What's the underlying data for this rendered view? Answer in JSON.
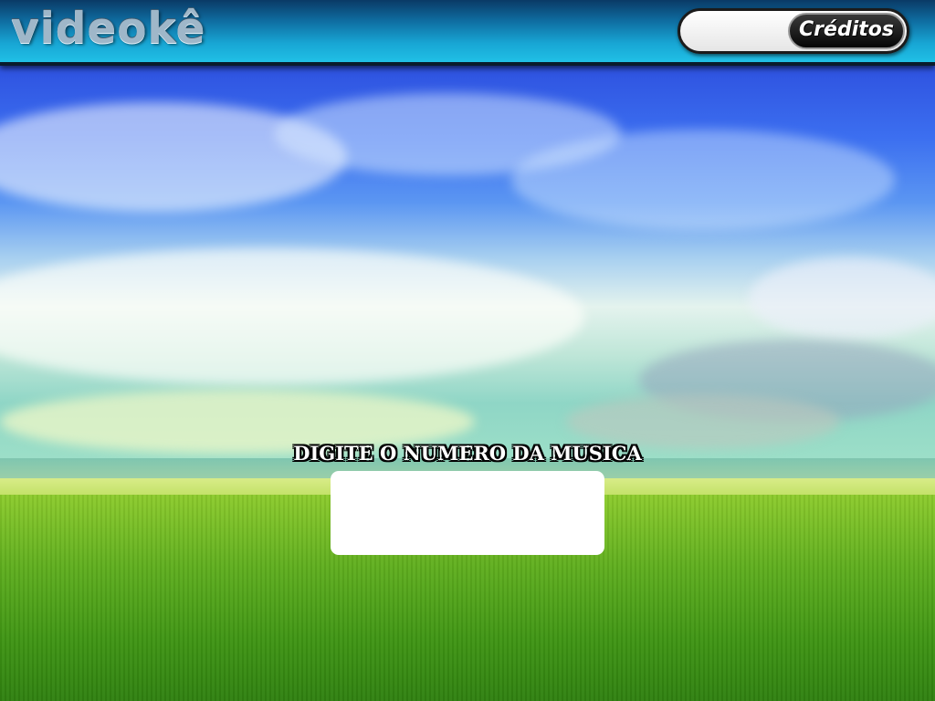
{
  "header": {
    "logo_text": "videokê",
    "credits_label": "Créditos",
    "credits_value": ""
  },
  "prompt": {
    "label": "DIGITE O NUMERO DA MUSICA",
    "input_value": ""
  },
  "colors": {
    "header_top": "#0a3a66",
    "header_bottom": "#20c0e6",
    "logo": "#9fb7c9",
    "input_bg": "#ffffff"
  },
  "background": {
    "description_icon": "sky-grass-landscape"
  }
}
